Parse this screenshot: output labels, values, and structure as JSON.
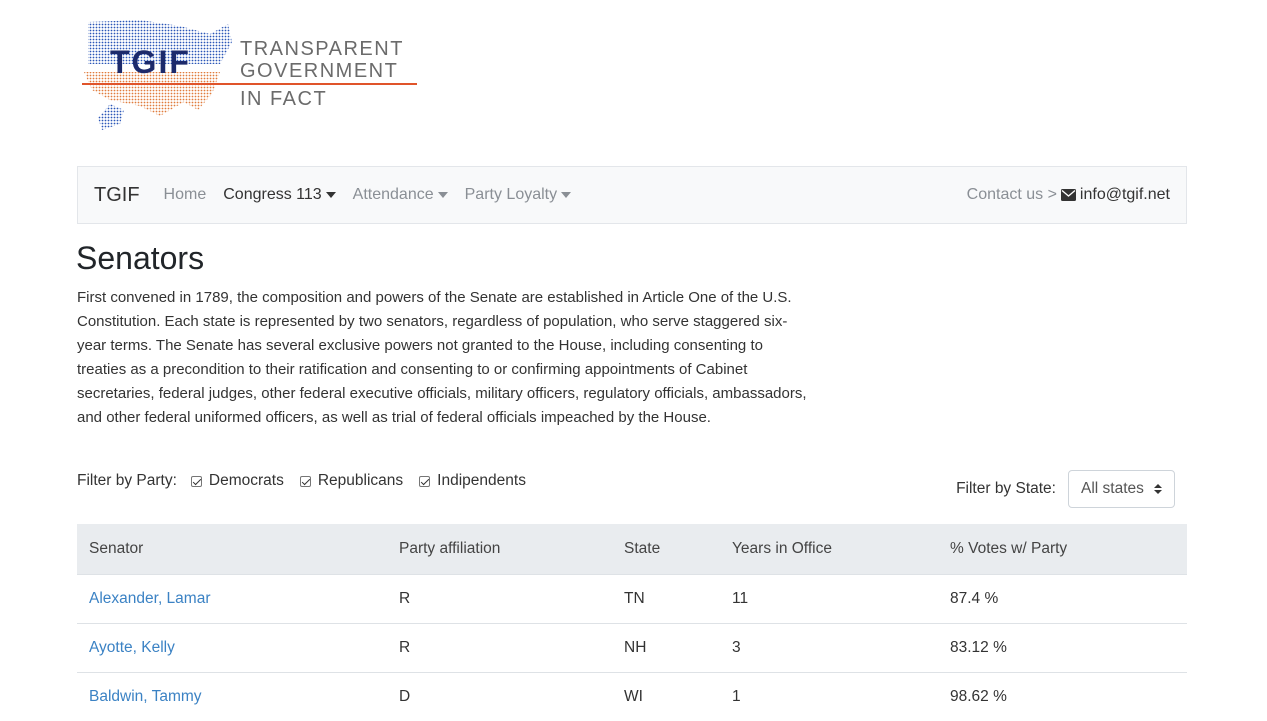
{
  "logo": {
    "acronym": "TGIF",
    "line1": "TRANSPARENT",
    "line2": "GOVERNMENT",
    "line3": "IN FACT",
    "colors": {
      "navy": "#1c2a6b",
      "accent": "#e0542a",
      "map_blue": "#2a56b8",
      "map_orange": "#e07b3c"
    }
  },
  "navbar": {
    "brand": "TGIF",
    "items": [
      {
        "label": "Home",
        "dropdown": false,
        "active": false
      },
      {
        "label": "Congress 113",
        "dropdown": true,
        "active": true
      },
      {
        "label": "Attendance",
        "dropdown": true,
        "active": false
      },
      {
        "label": "Party Loyalty",
        "dropdown": true,
        "active": false
      }
    ],
    "contact_label": "Contact us >",
    "email": "info@tgif.net",
    "email_icon": "envelope-icon"
  },
  "page": {
    "title": "Senators",
    "description": "First convened in 1789, the composition and powers of the Senate are established in Article One of the U.S. Constitution. Each state is represented by two senators, regardless of population, who serve staggered six-year terms. The Senate has several exclusive powers not granted to the House, including consenting to treaties as a precondition to their ratification and consenting to or confirming appointments of Cabinet secretaries, federal judges, other federal executive officials, military officers, regulatory officials, ambassadors, and other federal uniformed officers, as well as trial of federal officials impeached by the House."
  },
  "filters": {
    "party_label": "Filter by Party:",
    "parties": [
      {
        "label": "Democrats",
        "checked": true
      },
      {
        "label": "Republicans",
        "checked": true
      },
      {
        "label": "Indipendents",
        "checked": true
      }
    ],
    "state_label": "Filter by State:",
    "state_selected": "All states"
  },
  "table": {
    "headers": [
      "Senator",
      "Party affiliation",
      "State",
      "Years in Office",
      "% Votes w/ Party"
    ],
    "rows": [
      {
        "name": "Alexander, Lamar",
        "party": "R",
        "state": "TN",
        "years": "11",
        "votes": "87.4 %"
      },
      {
        "name": "Ayotte, Kelly",
        "party": "R",
        "state": "NH",
        "years": "3",
        "votes": "83.12 %"
      },
      {
        "name": "Baldwin, Tammy",
        "party": "D",
        "state": "WI",
        "years": "1",
        "votes": "98.62 %"
      }
    ]
  }
}
